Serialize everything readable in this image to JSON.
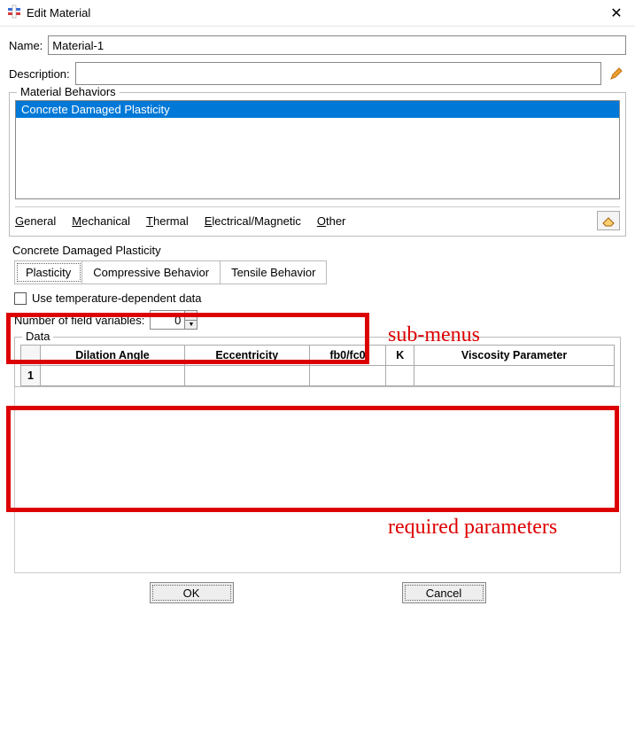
{
  "title": "Edit Material",
  "name_label": "Name:",
  "name_value": "Material-1",
  "description_label": "Description:",
  "description_value": "",
  "behaviors_group": "Material Behaviors",
  "behaviors": [
    "Concrete Damaged Plasticity"
  ],
  "menus": {
    "general": "General",
    "mechanical": "Mechanical",
    "thermal": "Thermal",
    "electrical": "Electrical/Magnetic",
    "other": "Other"
  },
  "section_title": "Concrete Damaged Plasticity",
  "tabs": {
    "plasticity": "Plasticity",
    "compressive": "Compressive Behavior",
    "tensile": "Tensile Behavior"
  },
  "use_temp": "Use temperature-dependent data",
  "num_field_vars_label": "Number of field variables:",
  "num_field_vars_value": "0",
  "data_group": "Data",
  "columns": [
    "Dilation Angle",
    "Eccentricity",
    "fb0/fc0",
    "K",
    "Viscosity Parameter"
  ],
  "rownum": "1",
  "buttons": {
    "ok": "OK",
    "cancel": "Cancel"
  },
  "annotations": {
    "submenus": "sub-menus",
    "required": "required parameters"
  }
}
